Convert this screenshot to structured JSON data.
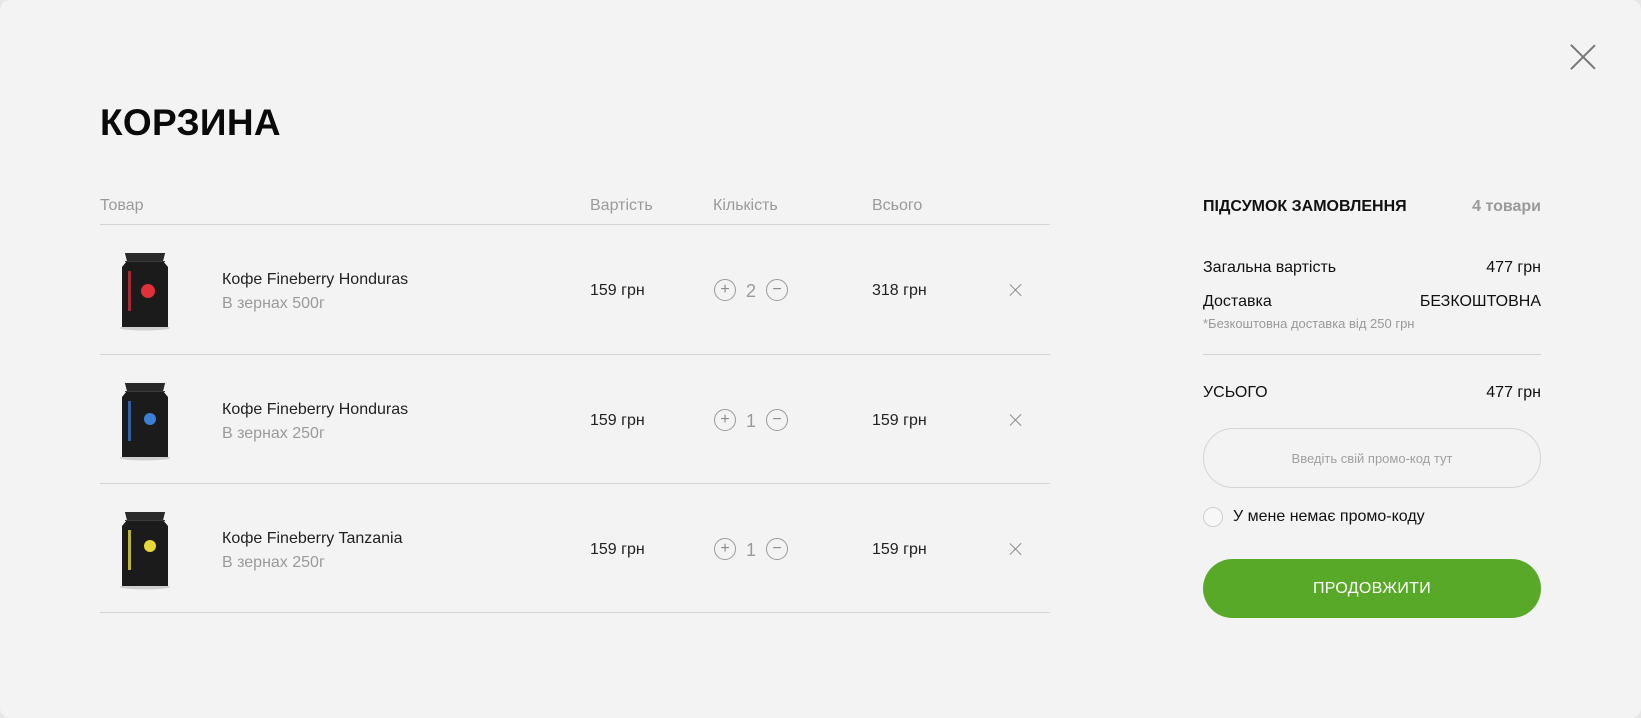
{
  "title": "КОРЗИНА",
  "table": {
    "headers": [
      "Товар",
      "Вартість",
      "Кількість",
      "Всього"
    ],
    "rows": [
      {
        "name": "Кофе Fineberry Honduras",
        "variant": "В зернах 500г",
        "price": "159 грн",
        "qty": "2",
        "total": "318 грн",
        "accent": "#e0313a"
      },
      {
        "name": "Кофе Fineberry Honduras",
        "variant": "В зернах 250г",
        "price": "159 грн",
        "qty": "1",
        "total": "159 грн",
        "accent": "#3b7fd6"
      },
      {
        "name": "Кофе Fineberry Tanzania",
        "variant": "В зернах 250г",
        "price": "159 грн",
        "qty": "1",
        "total": "159 грн",
        "accent": "#e6d83a"
      }
    ],
    "icons": {
      "plus": "plus-circle-icon",
      "minus": "minus-circle-icon",
      "remove": "close-icon"
    }
  },
  "summary": {
    "title": "ПІДСУМОК ЗАМОВЛЕННЯ",
    "count": "4 товари",
    "subtotal_label": "Загальна вартість",
    "subtotal_value": "477 грн",
    "delivery_label": "Доставка",
    "delivery_value": "БЕЗКОШТОВНА",
    "delivery_note": "*Безкоштовна доставка від 250 грн",
    "total_label": "УСЬОГО",
    "total_value": "477 грн",
    "promo_placeholder": "Введіть свій промо-код тут",
    "no_promo_label": "У мене немає промо-коду",
    "continue_label": "ПРОДОВЖИТИ"
  },
  "colors": {
    "accent": "#59a928",
    "background": "#f3f3f3",
    "muted_text": "#9a9a9a",
    "divider": "#d4d4d4"
  }
}
